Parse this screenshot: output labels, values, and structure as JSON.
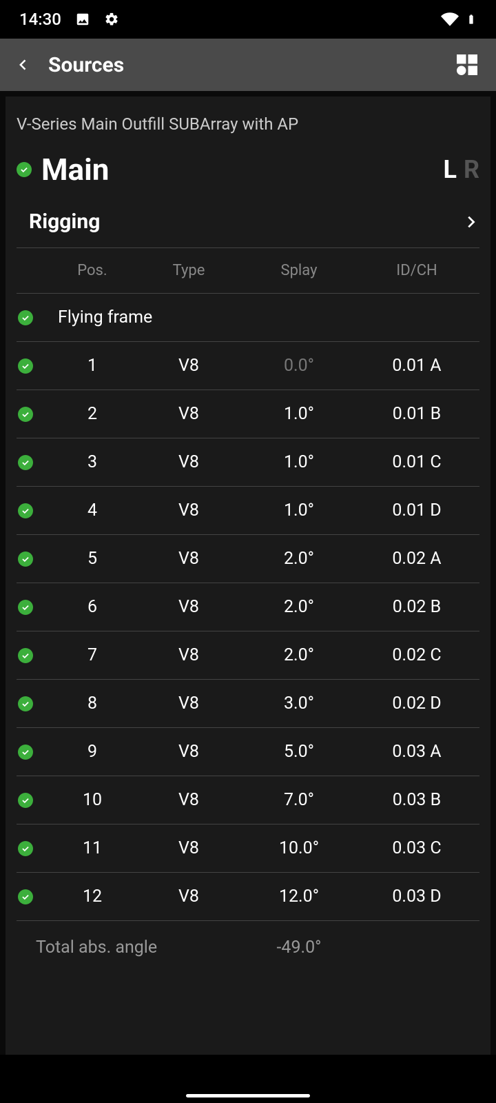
{
  "status": {
    "time": "14:30"
  },
  "appBar": {
    "title": "Sources"
  },
  "breadcrumb": "V-Series Main Outfill SUBArray with AP",
  "mainTitle": "Main",
  "lr": {
    "l": "L",
    "r": "R"
  },
  "sectionTitle": "Rigging",
  "headers": {
    "pos": "Pos.",
    "type": "Type",
    "splay": "Splay",
    "idch": "ID/CH"
  },
  "frameLabel": "Flying frame",
  "rows": [
    {
      "pos": "1",
      "type": "V8",
      "splay": "0.0°",
      "splayMuted": true,
      "idch": "0.01 A"
    },
    {
      "pos": "2",
      "type": "V8",
      "splay": "1.0°",
      "splayMuted": false,
      "idch": "0.01 B"
    },
    {
      "pos": "3",
      "type": "V8",
      "splay": "1.0°",
      "splayMuted": false,
      "idch": "0.01 C"
    },
    {
      "pos": "4",
      "type": "V8",
      "splay": "1.0°",
      "splayMuted": false,
      "idch": "0.01 D"
    },
    {
      "pos": "5",
      "type": "V8",
      "splay": "2.0°",
      "splayMuted": false,
      "idch": "0.02 A"
    },
    {
      "pos": "6",
      "type": "V8",
      "splay": "2.0°",
      "splayMuted": false,
      "idch": "0.02 B"
    },
    {
      "pos": "7",
      "type": "V8",
      "splay": "2.0°",
      "splayMuted": false,
      "idch": "0.02 C"
    },
    {
      "pos": "8",
      "type": "V8",
      "splay": "3.0°",
      "splayMuted": false,
      "idch": "0.02 D"
    },
    {
      "pos": "9",
      "type": "V8",
      "splay": "5.0°",
      "splayMuted": false,
      "idch": "0.03 A"
    },
    {
      "pos": "10",
      "type": "V8",
      "splay": "7.0°",
      "splayMuted": false,
      "idch": "0.03 B"
    },
    {
      "pos": "11",
      "type": "V8",
      "splay": "10.0°",
      "splayMuted": false,
      "idch": "0.03 C"
    },
    {
      "pos": "12",
      "type": "V8",
      "splay": "12.0°",
      "splayMuted": false,
      "idch": "0.03 D"
    }
  ],
  "footer": {
    "label": "Total abs. angle",
    "value": "-49.0°"
  }
}
